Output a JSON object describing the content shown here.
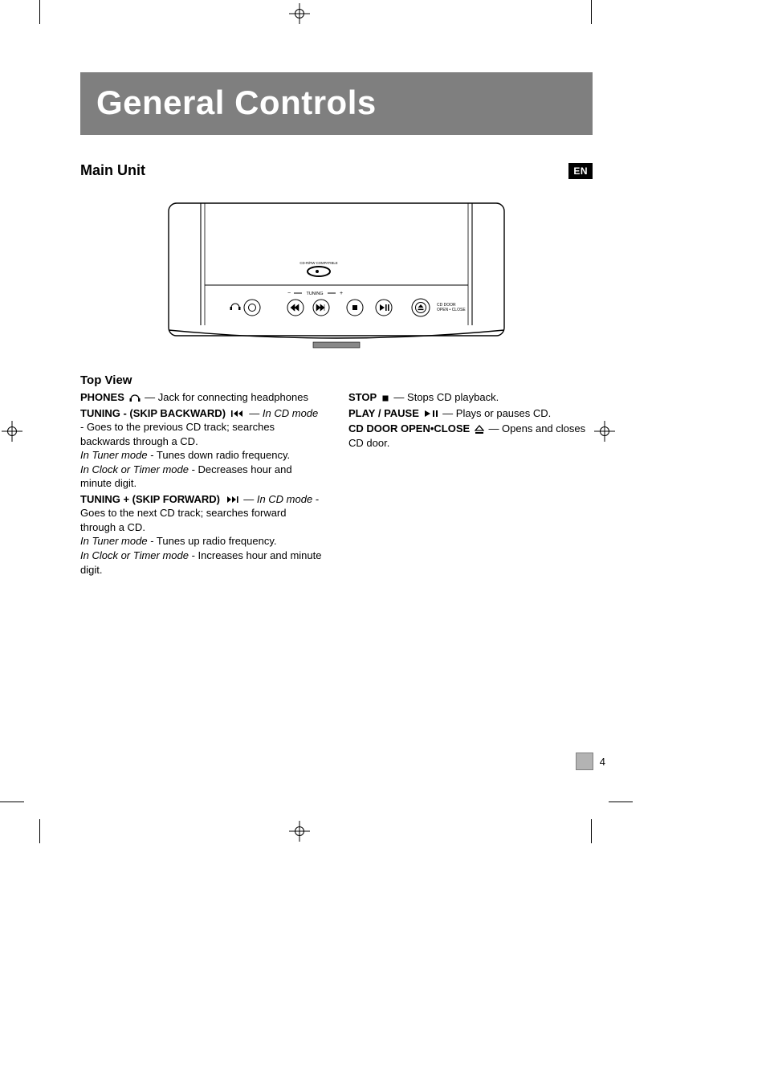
{
  "title": "General Controls",
  "section": "Main Unit",
  "lang_badge": "EN",
  "subheading": "Top View",
  "page_number": "4",
  "device_labels": {
    "tuning_header": "TUNING",
    "cd_door_caption_1": "CD DOOR",
    "cd_door_caption_2": "OPEN • CLOSE",
    "cd_compat": "CD-R/RW COMPATIBLE"
  },
  "left": [
    {
      "label": "PHONES",
      "icon": "headphones-icon",
      "lines": [
        "— Jack for connecting headphones"
      ]
    },
    {
      "label": "TUNING - (SKIP BACKWARD)",
      "icon": "skip-back-icon",
      "lines": [
        "— <em class='mode'>In CD mode</em> - Goes to the previous CD track;  searches backwards through a CD.",
        "<em class='mode'>In Tuner mode</em> - Tunes down radio frequency.",
        "<em class='mode'>In Clock or Timer mode</em> - Decreases hour and minute digit."
      ]
    },
    {
      "label": "TUNING + (SKIP FORWARD)",
      "icon": "skip-fwd-icon",
      "lines": [
        "— <em class='mode'>In CD mode</em> - Goes to the next CD track; searches forward through a CD.",
        "<em class='mode'>In Tuner mode</em> - Tunes up radio frequency.",
        "<em class='mode'>In Clock or Timer mode</em> - Increases hour and minute digit."
      ]
    }
  ],
  "right": [
    {
      "label": "STOP",
      "icon": "stop-icon",
      "lines": [
        "— Stops CD playback."
      ]
    },
    {
      "label": "PLAY / PAUSE",
      "icon": "play-pause-icon",
      "lines": [
        "— Plays or pauses CD."
      ]
    },
    {
      "label": "CD DOOR OPEN•CLOSE",
      "icon": "eject-icon",
      "lines": [
        "— Opens and closes CD door."
      ]
    }
  ]
}
